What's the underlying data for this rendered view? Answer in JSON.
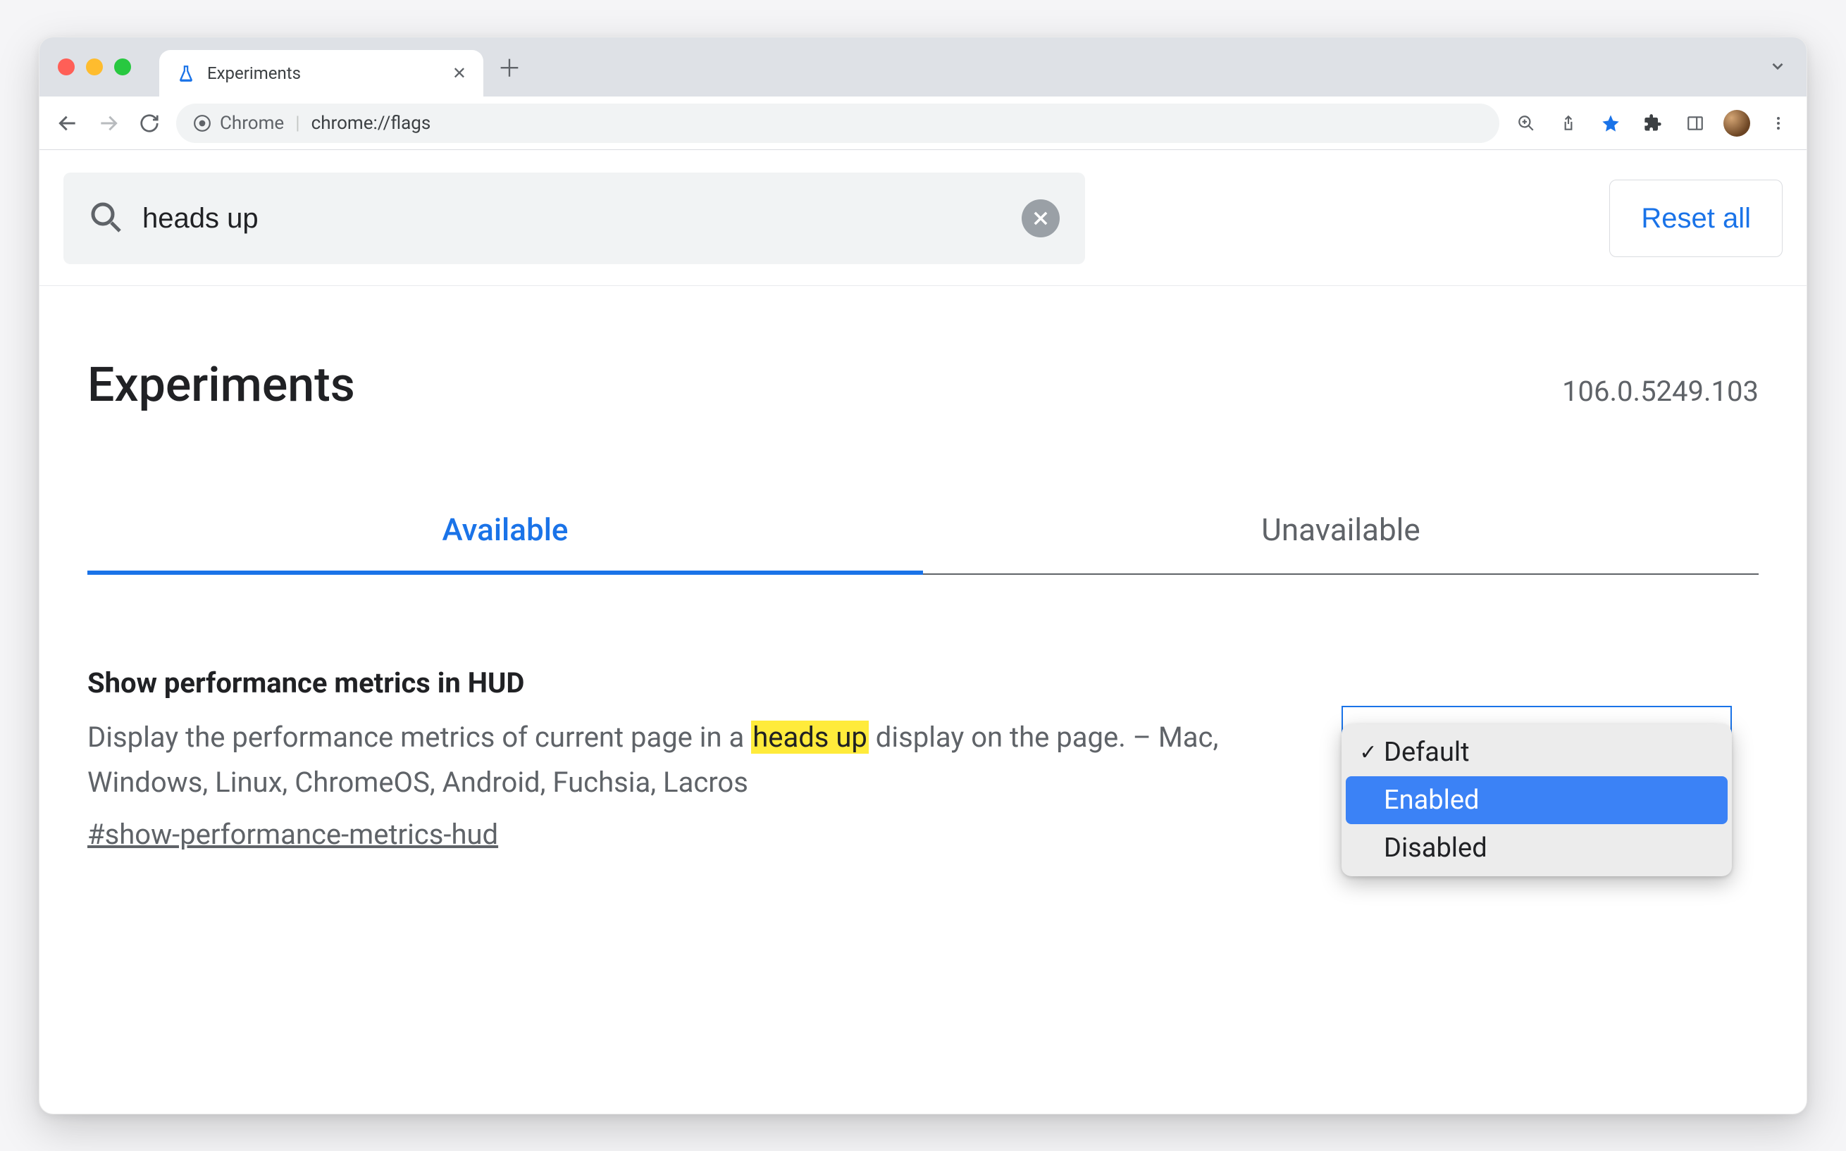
{
  "browser": {
    "tab": {
      "title": "Experiments",
      "favicon": "flask-icon"
    },
    "omnibox": {
      "indicator": "Chrome",
      "url": "chrome://flags"
    }
  },
  "search": {
    "value": "heads up",
    "reset_label": "Reset all"
  },
  "header": {
    "title": "Experiments",
    "version": "106.0.5249.103"
  },
  "tabs": {
    "available": "Available",
    "unavailable": "Unavailable"
  },
  "flag": {
    "title": "Show performance metrics in HUD",
    "desc_prefix": "Display the performance metrics of current page in a ",
    "desc_highlight": "heads up",
    "desc_suffix": " display on the page. – Mac, Windows, Linux, ChromeOS, Android, Fuchsia, Lacros",
    "hash": "#show-performance-metrics-hud",
    "dropdown": {
      "options": [
        "Default",
        "Enabled",
        "Disabled"
      ],
      "selected": "Default",
      "hovered": "Enabled"
    }
  }
}
